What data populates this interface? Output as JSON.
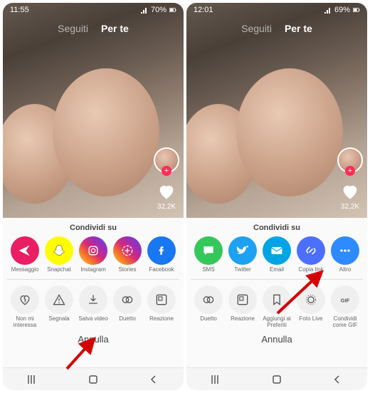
{
  "left": {
    "time": "11:55",
    "battery": "70%",
    "tabs": {
      "following": "Seguiti",
      "foryou": "Per te"
    },
    "like_count": "32,2K",
    "sheet_title": "Condividi su",
    "row1": [
      {
        "name": "messaggio",
        "label": "Messaggio",
        "bg": "#E91E63",
        "icon": "send"
      },
      {
        "name": "snapchat",
        "label": "Snapchat",
        "bg": "#FFFC00",
        "icon": "snap"
      },
      {
        "name": "instagram",
        "label": "Instagram",
        "bg": "ig",
        "icon": "ig"
      },
      {
        "name": "stories",
        "label": "Stories",
        "bg": "ig",
        "icon": "stories"
      },
      {
        "name": "facebook",
        "label": "Facebook",
        "bg": "#1877F2",
        "icon": "fb"
      }
    ],
    "row2": [
      {
        "name": "non-mi-interessa",
        "label": "Non mi\ninteressa",
        "icon": "heartbreak"
      },
      {
        "name": "segnala",
        "label": "Segnala",
        "icon": "warn"
      },
      {
        "name": "salva-video",
        "label": "Salva video",
        "icon": "download"
      },
      {
        "name": "duetto",
        "label": "Duetto",
        "icon": "duet"
      },
      {
        "name": "reazione",
        "label": "Reazione",
        "icon": "react"
      }
    ],
    "cancel": "Annulla"
  },
  "right": {
    "time": "12:01",
    "battery": "69%",
    "tabs": {
      "following": "Seguiti",
      "foryou": "Per te"
    },
    "like_count": "32,2K",
    "sheet_title": "Condividi su",
    "row1": [
      {
        "name": "sms",
        "label": "SMS",
        "bg": "#34C759",
        "icon": "sms"
      },
      {
        "name": "twitter",
        "label": "Twitter",
        "bg": "#1DA1F2",
        "icon": "tw"
      },
      {
        "name": "email",
        "label": "Email",
        "bg": "#00A4E4",
        "icon": "mail"
      },
      {
        "name": "copia-link",
        "label": "Copia link",
        "bg": "#4C6FFF",
        "icon": "link"
      },
      {
        "name": "altro",
        "label": "Altro",
        "bg": "#2E8BFF",
        "icon": "dots"
      }
    ],
    "row2": [
      {
        "name": "duetto",
        "label": "Duetto",
        "icon": "duet"
      },
      {
        "name": "reazione",
        "label": "Reazione",
        "icon": "react"
      },
      {
        "name": "aggiungi-preferiti",
        "label": "Aggiungi ai\nPreferiti",
        "icon": "bookmark"
      },
      {
        "name": "foto-live",
        "label": "Foto Live",
        "icon": "live"
      },
      {
        "name": "condividi-gif",
        "label": "Condividi\ncome GIF",
        "icon": "gif"
      }
    ],
    "cancel": "Annulla"
  }
}
